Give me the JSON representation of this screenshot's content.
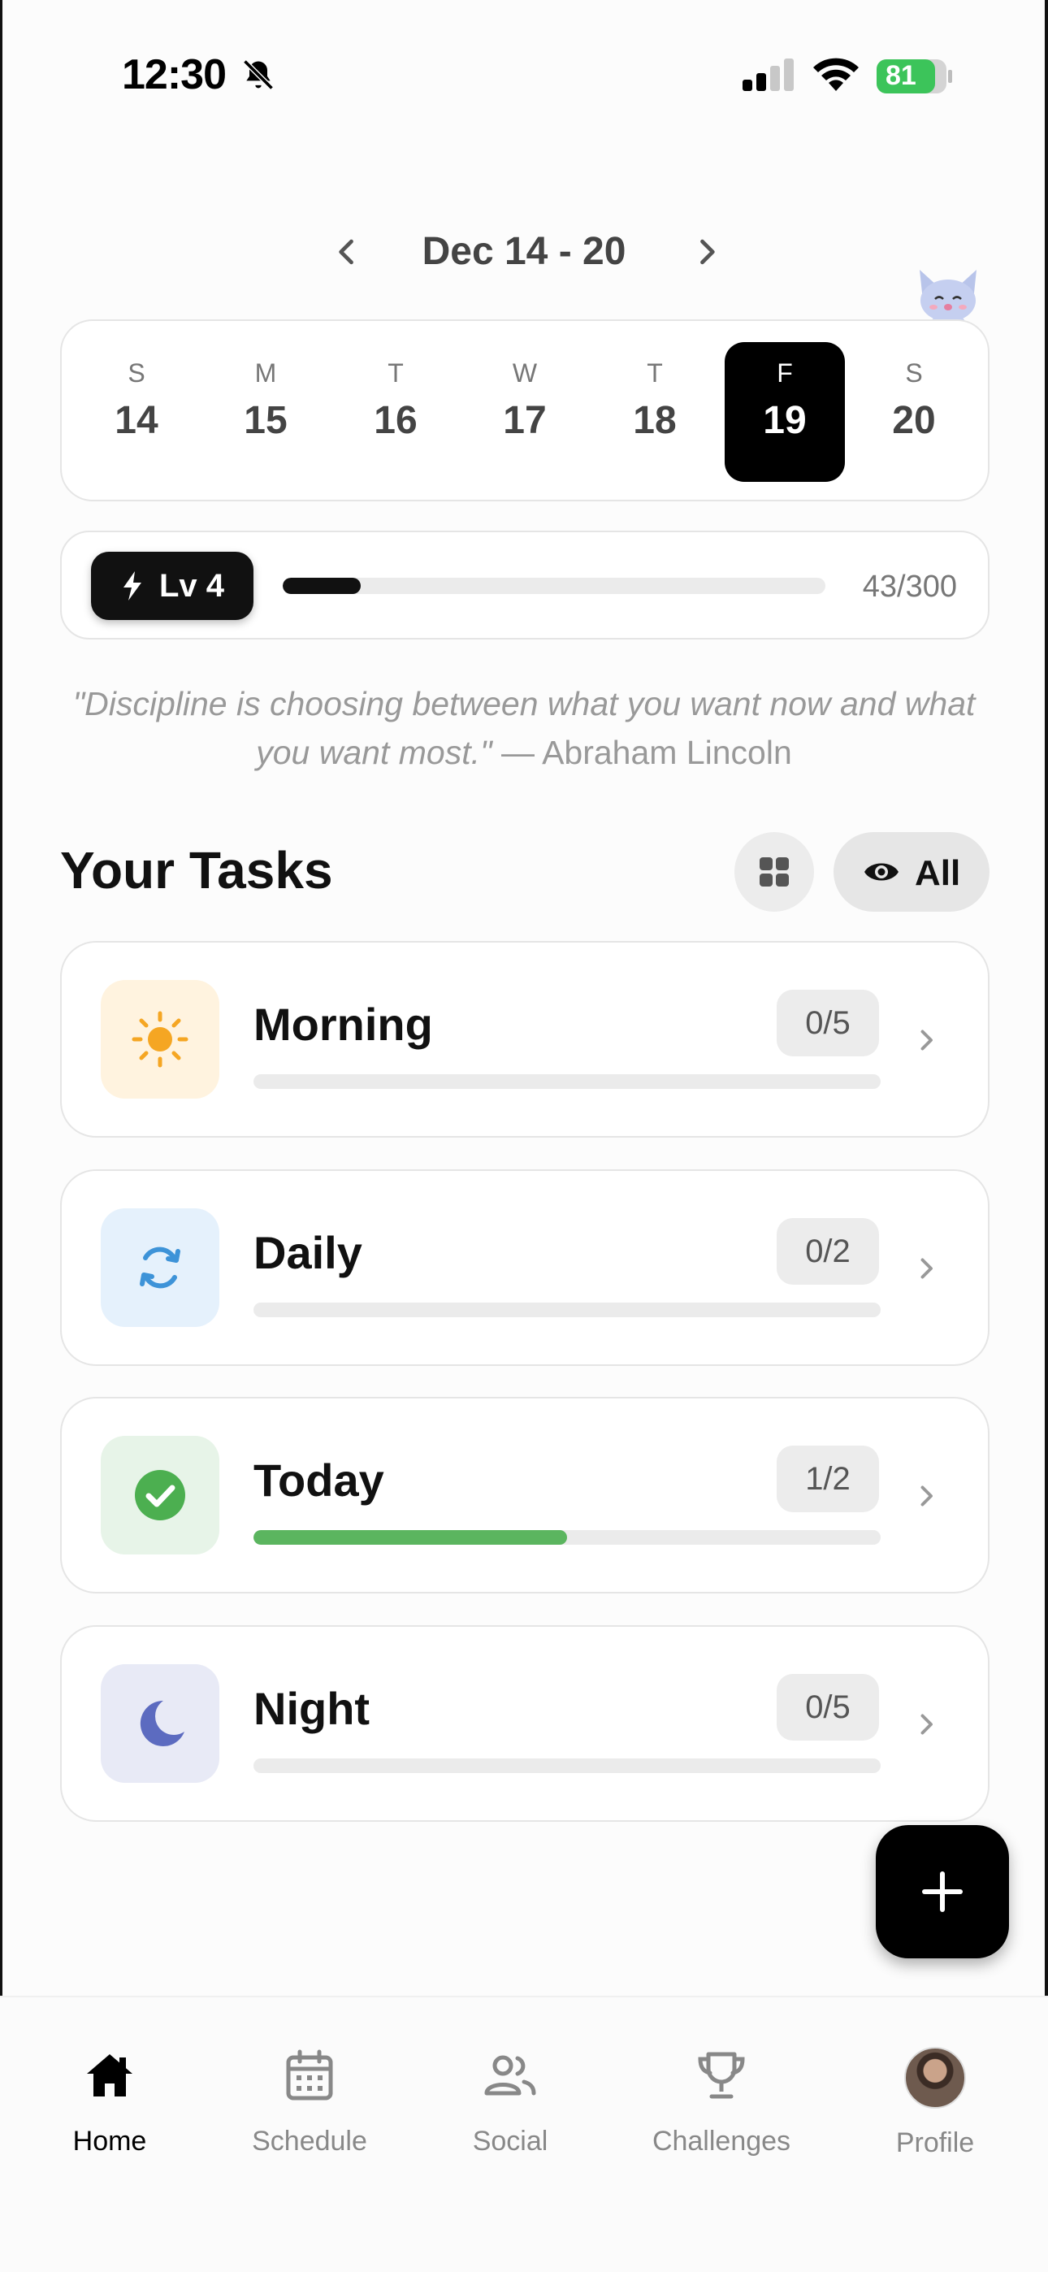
{
  "status_bar": {
    "time": "12:30",
    "battery": "81"
  },
  "week": {
    "range": "Dec 14 - 20"
  },
  "days": [
    {
      "dow": "S",
      "num": "14",
      "selected": false
    },
    {
      "dow": "M",
      "num": "15",
      "selected": false
    },
    {
      "dow": "T",
      "num": "16",
      "selected": false
    },
    {
      "dow": "W",
      "num": "17",
      "selected": false
    },
    {
      "dow": "T",
      "num": "18",
      "selected": false
    },
    {
      "dow": "F",
      "num": "19",
      "selected": true
    },
    {
      "dow": "S",
      "num": "20",
      "selected": false
    }
  ],
  "level": {
    "label": "Lv 4",
    "xp_text": "43/300",
    "progress": 0.143
  },
  "quote": {
    "text": "\"Discipline is choosing between what you want now and what you want most.\"",
    "author": " — Abraham Lincoln"
  },
  "tasks_header": {
    "title": "Your Tasks",
    "filter_label": "All"
  },
  "tasks": [
    {
      "name": "Morning",
      "count": "0/5",
      "progress": 0.0,
      "icon": "sun-icon",
      "icon_bg": "#fff3df",
      "icon_color": "#f5a623",
      "fill_color": "#5bb55f"
    },
    {
      "name": "Daily",
      "count": "0/2",
      "progress": 0.0,
      "icon": "repeat-icon",
      "icon_bg": "#e5f1fc",
      "icon_color": "#3d93d8",
      "fill_color": "#5bb55f"
    },
    {
      "name": "Today",
      "count": "1/2",
      "progress": 0.5,
      "icon": "check-circle-icon",
      "icon_bg": "#e7f4e8",
      "icon_color": "#4caf50",
      "fill_color": "#5bb55f"
    },
    {
      "name": "Night",
      "count": "0/5",
      "progress": 0.0,
      "icon": "moon-icon",
      "icon_bg": "#e8eaf6",
      "icon_color": "#5c6bc0",
      "fill_color": "#5bb55f"
    }
  ],
  "nav": [
    {
      "label": "Home",
      "icon": "home-icon",
      "active": true
    },
    {
      "label": "Schedule",
      "icon": "calendar-icon",
      "active": false
    },
    {
      "label": "Social",
      "icon": "people-icon",
      "active": false
    },
    {
      "label": "Challenges",
      "icon": "trophy-icon",
      "active": false
    },
    {
      "label": "Profile",
      "icon": "avatar",
      "active": false
    }
  ]
}
